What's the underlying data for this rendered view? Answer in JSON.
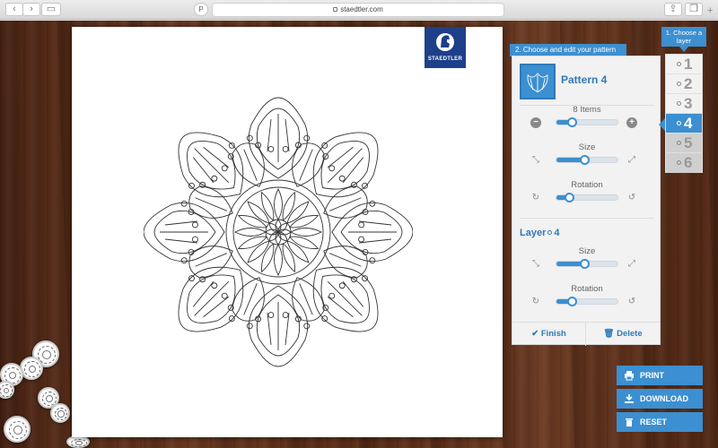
{
  "browser": {
    "url": "staedtler.com",
    "back_icon": "chevron-left-icon",
    "forward_icon": "chevron-right-icon",
    "pinterest_icon": "pinterest-icon"
  },
  "brand": {
    "name": "STAEDTLER",
    "color": "#1e3f8a"
  },
  "pattern_panel": {
    "tab_label": "2. Choose and edit your pattern",
    "pattern_name": "Pattern 4",
    "items_label": "8 Items",
    "items_level": 0.25,
    "size_label": "Size",
    "size_level": 0.45,
    "rotation_label": "Rotation",
    "rotation_level": 0.2,
    "layer_heading": "Layer",
    "layer_number": "4",
    "layer_size_label": "Size",
    "layer_size_level": 0.45,
    "layer_rotation_label": "Rotation",
    "layer_rotation_level": 0.25,
    "finish_label": "Finish",
    "delete_label": "Delete"
  },
  "layer_chooser": {
    "tab_label": "1. Choose a layer",
    "layers": [
      "1",
      "2",
      "3",
      "4",
      "5",
      "6"
    ],
    "active_index": 3
  },
  "actions": {
    "print_label": "PRINT",
    "download_label": "DOWNLOAD",
    "reset_label": "RESET"
  },
  "colors": {
    "accent": "#3c8fd0",
    "wood": "#5a2e18"
  }
}
